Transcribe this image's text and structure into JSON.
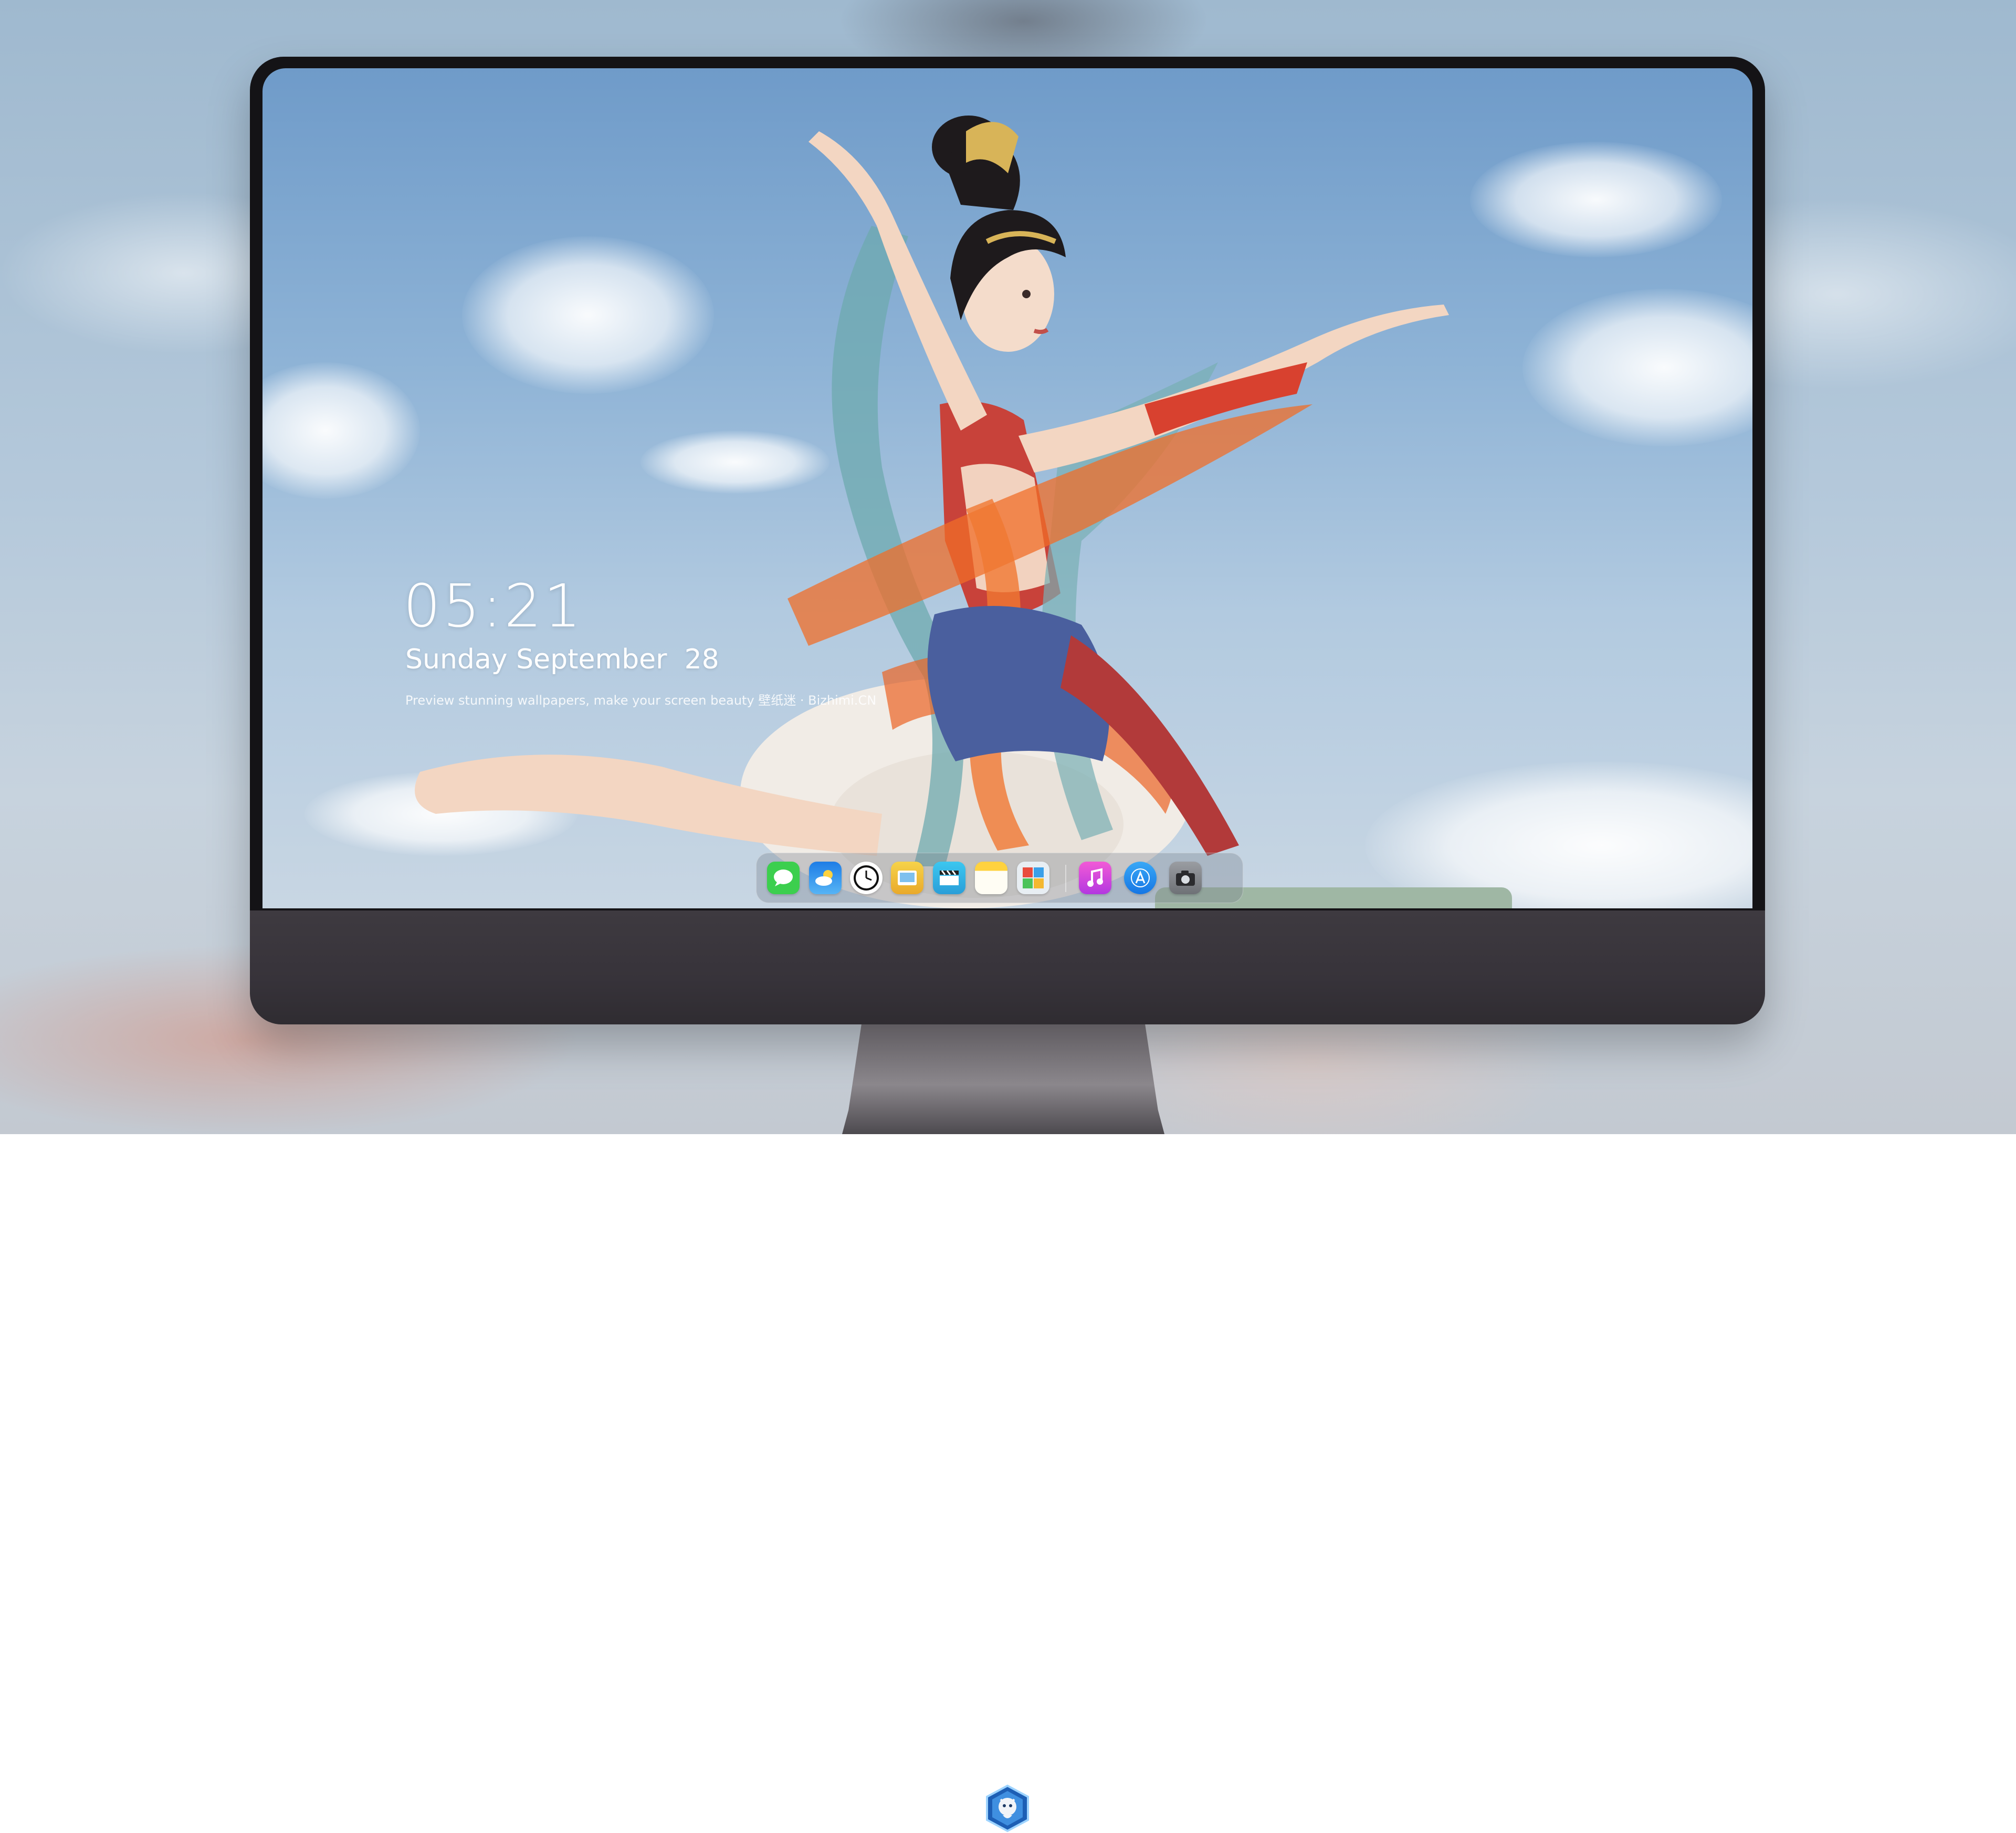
{
  "lockscreen": {
    "time": "05:21",
    "date": "Sunday September  28",
    "tagline": "Preview stunning wallpapers, make your screen beauty  壁纸迷 · Bizhimi.CN"
  },
  "dock": {
    "apps": [
      {
        "name": "messages-icon",
        "color": "#3ccf4e"
      },
      {
        "name": "weather-icon",
        "color": "#2b8ce8"
      },
      {
        "name": "clock-icon",
        "color": "#ffffff"
      },
      {
        "name": "preview-icon",
        "color": "#f3c53a"
      },
      {
        "name": "videos-icon",
        "color": "#35b8e8"
      },
      {
        "name": "notes-icon",
        "color": "#ffd23f"
      },
      {
        "name": "photo-booth-icon",
        "color": "#e8eef3"
      },
      {
        "name": "music-icon",
        "color": "#e040c8"
      },
      {
        "name": "app-store-icon",
        "color": "#1f8ef1"
      },
      {
        "name": "camera-icon",
        "color": "#8a8d92"
      }
    ]
  }
}
